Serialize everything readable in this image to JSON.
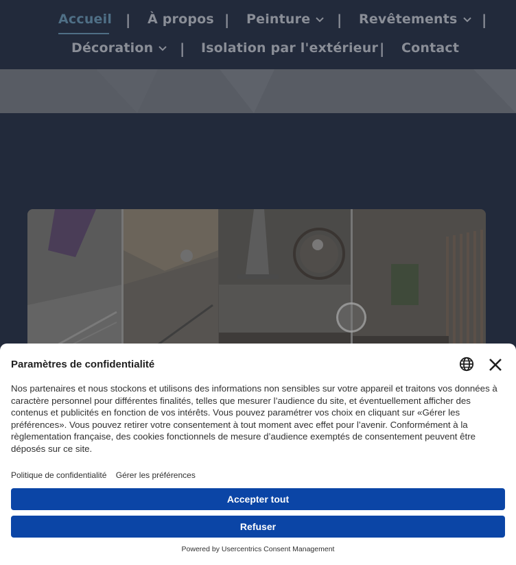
{
  "nav": {
    "items": [
      {
        "label": "Accueil"
      },
      {
        "label": "À propos"
      },
      {
        "label": "Peinture"
      },
      {
        "label": "Revêtements"
      },
      {
        "label": "Décoration"
      },
      {
        "label": "Isolation par l'extérieur"
      },
      {
        "label": "Contact"
      }
    ],
    "separator": "|",
    "active_color": "#4f6f86",
    "text_color": "#8a8e97",
    "background": "#222a3b"
  },
  "gallery": {
    "icons": {
      "play": "play-icon"
    }
  },
  "consent": {
    "title": "Paramètres de confidentialité",
    "body": "Nos partenaires et nous stockons et utilisons des informations non sensibles sur votre appareil et traitons vos données à caractère personnel pour différentes finalités, telles que mesurer l’audience du site, et éventuellement afficher des contenus et publicités en fonction de vos intérêts. Vous pouvez paramétrer vos choix en cliquant sur «Gérer les préférences». Vous pouvez retirer votre consentement à tout moment avec effet pour l’avenir. Conformément à la règlementation française, des cookies fonctionnels de mesure d’audience exemptés de consentement peuvent être déposés sur ce site.",
    "link_privacy": "Politique de confidentialité",
    "link_manage": "Gérer les préférences",
    "accept_label": "Accepter tout",
    "refuse_label": "Refuser",
    "powered_by": "Powered by Usercentrics Consent Management",
    "button_color": "#0b45a6",
    "icons": {
      "language": "globe-icon",
      "close": "close-icon"
    }
  }
}
